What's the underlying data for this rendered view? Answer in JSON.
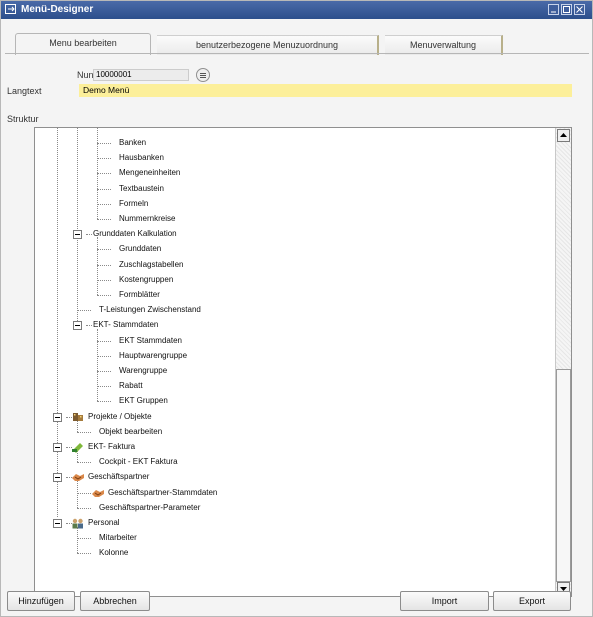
{
  "window": {
    "title": "Menü-Designer"
  },
  "tabs": [
    {
      "label": "Menu bearbeiten",
      "active": true
    },
    {
      "label": "benutzerbezogene Menuzuordnung",
      "active": false
    },
    {
      "label": "Menuverwaltung",
      "active": false
    }
  ],
  "form": {
    "num_label": "Nun",
    "num_value": "10000001",
    "langtext_label": "Langtext",
    "langtext_value": "Demo Menü",
    "struktur_label": "Struktur"
  },
  "tree": [
    {
      "label": "Banken",
      "level": 3
    },
    {
      "label": "Hausbanken",
      "level": 3
    },
    {
      "label": "Mengeneinheiten",
      "level": 3
    },
    {
      "label": "Textbaustein",
      "level": 3
    },
    {
      "label": "Formeln",
      "level": 3
    },
    {
      "label": "Nummernkreise",
      "level": 3
    },
    {
      "label": "Grunddaten Kalkulation",
      "level": 2,
      "expanded": true
    },
    {
      "label": "Grunddaten",
      "level": 3
    },
    {
      "label": "Zuschlagstabellen",
      "level": 3
    },
    {
      "label": "Kostengruppen",
      "level": 3
    },
    {
      "label": "Formblätter",
      "level": 3
    },
    {
      "label": "T-Leistungen Zwischenstand",
      "level": 2
    },
    {
      "label": "EKT- Stammdaten",
      "level": 2,
      "expanded": true
    },
    {
      "label": "EKT Stammdaten",
      "level": 3
    },
    {
      "label": "Hauptwarengruppe",
      "level": 3
    },
    {
      "label": "Warengruppe",
      "level": 3
    },
    {
      "label": "Rabatt",
      "level": 3
    },
    {
      "label": "EKT Gruppen",
      "level": 3
    },
    {
      "label": "Projekte / Objekte",
      "level": 1,
      "expanded": true,
      "icon": "projects-icon"
    },
    {
      "label": "Objekt bearbeiten",
      "level": 2
    },
    {
      "label": "EKT- Faktura",
      "level": 1,
      "expanded": true,
      "icon": "faktura-icon"
    },
    {
      "label": "Cockpit - EKT Faktura",
      "level": 2
    },
    {
      "label": "Geschäftspartner",
      "level": 1,
      "expanded": true,
      "icon": "partner-icon"
    },
    {
      "label": "Geschäftspartner-Stammdaten",
      "level": 2,
      "icon": "partner-icon"
    },
    {
      "label": "Geschäftspartner-Parameter",
      "level": 2
    },
    {
      "label": "Personal",
      "level": 1,
      "expanded": true,
      "icon": "personal-icon"
    },
    {
      "label": "Mitarbeiter",
      "level": 2
    },
    {
      "label": "Kolonne",
      "level": 2
    }
  ],
  "buttons": {
    "add": "Hinzufügen",
    "cancel": "Abbrechen",
    "import": "Import",
    "export": "Export"
  }
}
